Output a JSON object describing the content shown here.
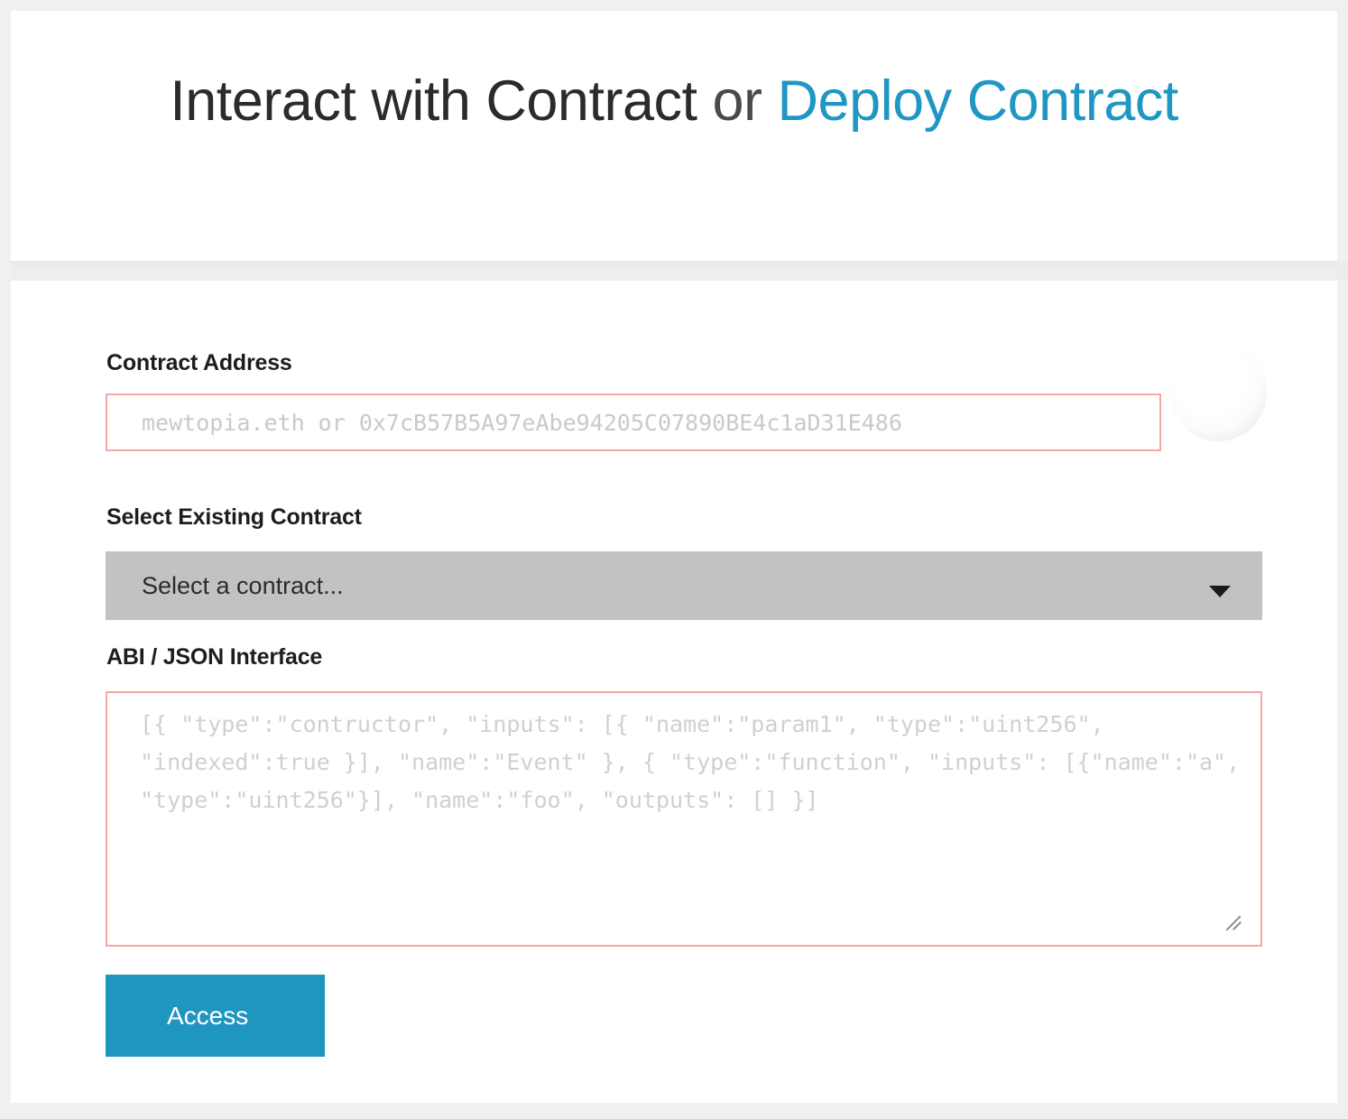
{
  "header": {
    "title_part1": "Interact with Contract",
    "title_conjunction": " or ",
    "title_link": "Deploy Contract"
  },
  "form": {
    "contract_address": {
      "label": "Contract Address",
      "value": "",
      "placeholder": "mewtopia.eth or 0x7cB57B5A97eAbe94205C07890BE4c1aD31E486"
    },
    "identicon": {
      "name": "blank-identicon"
    },
    "select_existing_contract": {
      "label": "Select Existing Contract",
      "selected": "Select a contract...",
      "options": [
        "Select a contract..."
      ],
      "arrow_icon": "chevron-down-icon"
    },
    "abi_json_interface": {
      "label": "ABI / JSON Interface",
      "value": "",
      "placeholder": "[{ \"type\":\"contructor\", \"inputs\": [{ \"name\":\"param1\", \"type\":\"uint256\", \"indexed\":true }], \"name\":\"Event\" }, { \"type\":\"function\", \"inputs\": [{\"name\":\"a\", \"type\":\"uint256\"}], \"name\":\"foo\", \"outputs\": [] }]"
    },
    "submit": {
      "label": "Access"
    }
  },
  "colors": {
    "accent": "#1f96c0",
    "link": "#1f96c4",
    "invalid_border": "#f4a7a7",
    "select_background": "#c2c2c2",
    "page_background": "#f0f0f0"
  }
}
